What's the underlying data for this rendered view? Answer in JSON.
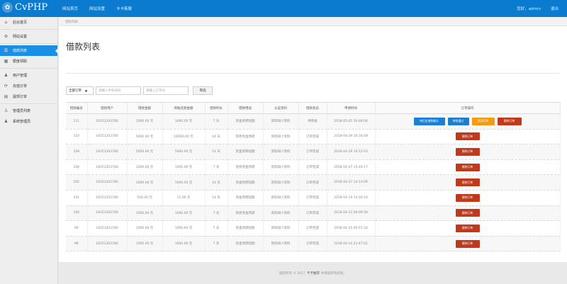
{
  "header": {
    "logo_text": "CvPHP",
    "nav": [
      "网站首页",
      "网站设置",
      "卡卡客服"
    ],
    "user": "您好，admin",
    "logout": "退出"
  },
  "sidebar": {
    "items": [
      {
        "label": "后台首页",
        "icon": "home-icon",
        "glyph": "⌂"
      },
      {
        "label": "网站设置",
        "icon": "gear-icon",
        "glyph": "⚙"
      },
      {
        "label": "借款列表",
        "icon": "list-icon",
        "glyph": "☰",
        "active": true
      },
      {
        "label": "额度领取",
        "icon": "table-icon",
        "glyph": "▦"
      },
      {
        "label": "用户管理",
        "icon": "user-icon",
        "glyph": "♟"
      },
      {
        "label": "充值订单",
        "icon": "recharge-icon",
        "glyph": "⟳"
      },
      {
        "label": "提现订单",
        "icon": "card-icon",
        "glyph": "▤"
      },
      {
        "label": "管理员列表",
        "icon": "admin-icon",
        "glyph": "♙"
      },
      {
        "label": "系统管理员",
        "icon": "system-icon",
        "glyph": "♟"
      }
    ]
  },
  "breadcrumb": "借款列表",
  "page_title": "借款列表",
  "filters": {
    "status_select": "全部订单",
    "phone_placeholder": "请输入手机号码",
    "order_placeholder": "请输入订单号",
    "search_label": "筛选"
  },
  "table": {
    "headers": [
      "借款编号",
      "借款用户",
      "借款金额",
      "到账还款金额",
      "借款时长",
      "借款用途",
      "认证资料",
      "借款状态",
      "申请时间",
      "订单操作"
    ],
    "rows": [
      {
        "id": "111",
        "user": "18351203780",
        "amount": "1000.00 元",
        "repay": "1000.00 元",
        "term": "7 天",
        "purpose": "资金周转短期",
        "auth": "资料缺少资料",
        "status": "待审核",
        "time": "2018-05-05 10:48:06",
        "actions": [
          "待后台放款确认",
          "审核通过",
          "驳回订单",
          "删除订单"
        ]
      },
      {
        "id": "110",
        "user": "18351203780",
        "amount": "5000.00 元",
        "repay": "18000.00 元",
        "term": "14 天",
        "purpose": "装修资金周转",
        "auth": "资料缺少资料",
        "status": "订单完成",
        "time": "2018-04-29 10:34:08",
        "actions": [
          "删除订单"
        ]
      },
      {
        "id": "109",
        "user": "18351203780",
        "amount": "5000.00 元",
        "repay": "5000.00 元",
        "term": "14 天",
        "purpose": "资金周转短期",
        "auth": "资料缺少资料",
        "status": "订单完成",
        "time": "2018-04-29 16:12:03",
        "actions": [
          "删除订单"
        ]
      },
      {
        "id": "106",
        "user": "18351203780",
        "amount": "1000.00 元",
        "repay": "1000.00 元",
        "term": "7 天",
        "purpose": "装修资金周转",
        "auth": "资料缺少资料",
        "status": "订单完成",
        "time": "2018-04-27 15:49:17",
        "actions": [
          "删除订单"
        ]
      },
      {
        "id": "105",
        "user": "18351203780",
        "amount": "1000.00 元",
        "repay": "1000.00 元",
        "term": "14 天",
        "purpose": "资金周转短期",
        "auth": "资料缺少资料",
        "status": "订单完成",
        "time": "2018-04-27 14:13:09",
        "actions": [
          "删除订单"
        ]
      },
      {
        "id": "101",
        "user": "18351203780",
        "amount": "500.00 元",
        "repay": "11.00 元",
        "term": "14 天",
        "purpose": "资金周转短期",
        "auth": "资料缺少资料",
        "status": "订单完成",
        "time": "2018-04-19 14:30:19",
        "actions": [
          "删除订单"
        ]
      },
      {
        "id": "100",
        "user": "18351203780",
        "amount": "1000.00 元",
        "repay": "1000.00 元",
        "term": "7 天",
        "purpose": "装修资金周转",
        "auth": "资料缺少资料",
        "status": "订单完成",
        "time": "2018-04-15 00:09:39",
        "actions": [
          "删除订单"
        ]
      },
      {
        "id": "99",
        "user": "18351203780",
        "amount": "1000.00 元",
        "repay": "1000.00 元",
        "term": "7 天",
        "purpose": "资金周转短期",
        "auth": "资料缺少资料",
        "status": "订单完成",
        "time": "2018-04-15 00:07:34",
        "actions": [
          "删除订单"
        ]
      },
      {
        "id": "98",
        "user": "18351203780",
        "amount": "1000.00 元",
        "repay": "1000.00 元",
        "term": "7 天",
        "purpose": "资金周转短期",
        "auth": "资料缺少资料",
        "status": "订单完成",
        "time": "2018-04-14 21:47:02",
        "actions": [
          "删除订单"
        ]
      }
    ]
  },
  "footer": {
    "prefix": "版权所有 © 2017",
    "brand": "卡卡推荐",
    "suffix": "并保留所有权利。"
  },
  "colors": {
    "topbar": "#0b7bd0",
    "active": "#1a8fe3",
    "btn_blue": "#1a7fd6",
    "btn_orange": "#f39c12",
    "btn_red": "#c0391b"
  }
}
